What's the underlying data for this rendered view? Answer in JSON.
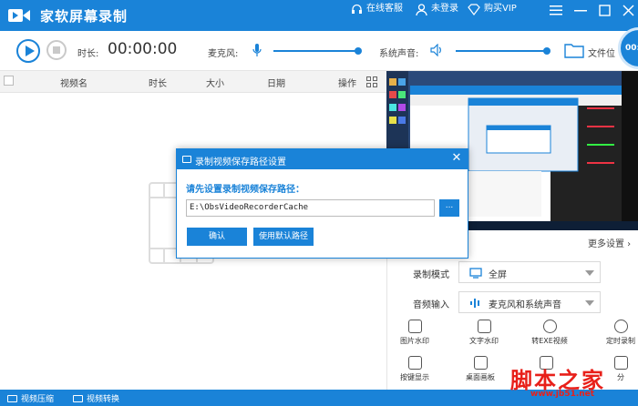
{
  "app": {
    "title": "家软屏幕录制"
  },
  "titlebar": {
    "service_label": "在线客服",
    "login_label": "未登录",
    "vip_label": "购买VIP"
  },
  "controls": {
    "duration_label": "时长:",
    "timer": "00:00:00",
    "mic_label": "麦克风:",
    "sys_audio_label": "系统声音:",
    "file_pos_label": "文件位",
    "record_label": "00:"
  },
  "table": {
    "headers": [
      "视频名",
      "时长",
      "大小",
      "日期",
      "操作"
    ]
  },
  "right_panel": {
    "more_settings": "更多设置",
    "mode_label": "录制模式",
    "mode_value": "全屏",
    "audio_label": "音频输入",
    "audio_value": "麦克风和系统声音",
    "tools": [
      "图片水印",
      "文字水印",
      "转EXE视频",
      "定时录制",
      "按键显示",
      "桌面画板",
      "",
      "分"
    ]
  },
  "footer": {
    "compress": "视频压缩",
    "convert": "视频转换"
  },
  "watermark": {
    "text": "脚本之家",
    "url": "www.jb51.net"
  },
  "dialog": {
    "title": "录制视频保存路径设置",
    "prompt": "请先设置录制视频保存路径：",
    "path_value": "E:\\ObsVideoRecorderCache",
    "browse_label": "...",
    "confirm_label": "确认",
    "default_label": "使用默认路径"
  }
}
